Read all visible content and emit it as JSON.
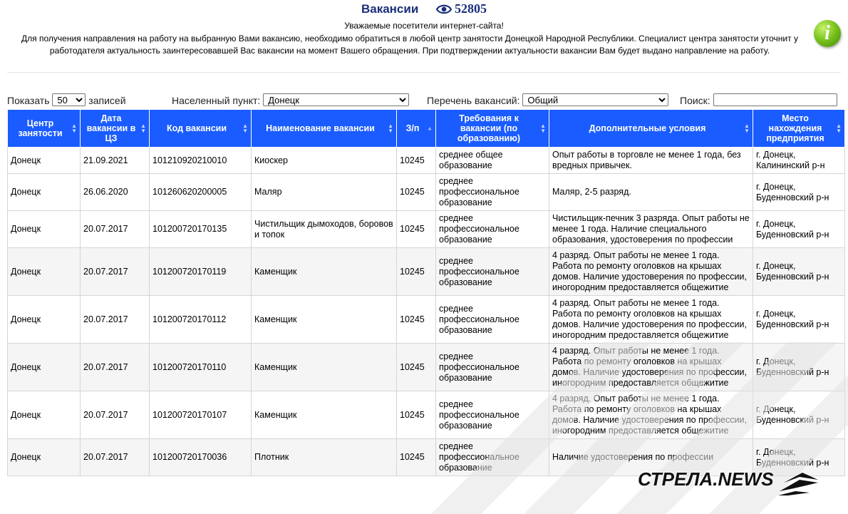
{
  "header": {
    "title": "Вакансии",
    "views_count": "52805",
    "greeting": "Уважаемые посетители интернет-сайта!",
    "notice_line1": "Для получения направления на работу на выбранную Вами вакансию, необходимо обратиться в любой центр занятости Донецкой Народной Республики. Специалист центра занятости уточнит у",
    "notice_line2": "работодателя актуальность заинтересовавшей Вас вакансии на момент Вашего обращения. При подтверждении актуальности вакансии Вам будет выдано направление на работу.",
    "info_icon_glyph": "i"
  },
  "controls": {
    "show_label": "Показать",
    "show_value": "50",
    "records_label": "записей",
    "locality_label": "Населенный пункт:",
    "locality_value": "Донецк",
    "vacancy_list_label": "Перечень вакансий:",
    "vacancy_list_value": "Общий",
    "search_label": "Поиск:",
    "search_value": ""
  },
  "table": {
    "columns": [
      "Центр занятости",
      "Дата вакансии в ЦЗ",
      "Код вакансии",
      "Наименование вакансии",
      "З/п",
      "Требования к вакансии (по образованию)",
      "Дополнительные условия",
      "Место нахождения предприятия"
    ],
    "rows": [
      [
        "Донецк",
        "21.09.2021",
        "101210920210010",
        "Киоскер",
        "10245",
        "среднее общее образование",
        "Опыт работы в торговле не менее 1 года, без вредных привычек.",
        "г. Донецк, Калининский р-н"
      ],
      [
        "Донецк",
        "26.06.2020",
        "101260620200005",
        "Маляр",
        "10245",
        "среднее профессиональное образование",
        "Маляр, 2-5 разряд.",
        "г. Донецк, Буденновский р-н"
      ],
      [
        "Донецк",
        "20.07.2017",
        "101200720170135",
        "Чистильщик дымоходов, боровов и топок",
        "10245",
        "среднее профессиональное образование",
        "Чистильщик-печник 3 разряда. Опыт работы не менее 1 года. Наличие специального образования, удостоверения по профессии",
        "г. Донецк, Буденновский р-н"
      ],
      [
        "Донецк",
        "20.07.2017",
        "101200720170119",
        "Каменщик",
        "10245",
        "среднее профессиональное образование",
        "4 разряд. Опыт работы не менее 1 года. Работа по ремонту оголовков на крышах домов. Наличие удостоверения по профессии, иногородним предоставляется общежитие",
        "г. Донецк, Буденновский р-н"
      ],
      [
        "Донецк",
        "20.07.2017",
        "101200720170112",
        "Каменщик",
        "10245",
        "среднее профессиональное образование",
        "4 разряд. Опыт работы не менее 1 года. Работа по ремонту оголовков на крышах домов. Наличие удостоверения по профессии, иногородним предоставляется общежитие",
        "г. Донецк, Буденновский р-н"
      ],
      [
        "Донецк",
        "20.07.2017",
        "101200720170110",
        "Каменщик",
        "10245",
        "среднее профессиональное образование",
        "4 разряд. Опыт работы не менее 1 года. Работа по ремонту оголовков на крышах домов. Наличие удостоверения по профессии, иногородним предоставляется общежитие",
        "г. Донецк, Буденновский р-н"
      ],
      [
        "Донецк",
        "20.07.2017",
        "101200720170107",
        "Каменщик",
        "10245",
        "среднее профессиональное образование",
        "4 разряд. Опыт работы не менее 1 года. Работа по ремонту оголовков на крышах домов. Наличие удостоверения по профессии, иногородним предоставляется общежитие",
        "г. Донецк, Буденновский р-н"
      ],
      [
        "Донецк",
        "20.07.2017",
        "101200720170036",
        "Плотник",
        "10245",
        "среднее профессиональное образование",
        "Наличие удостоверения по профессии",
        "г. Донецк, Буденновский р-н"
      ]
    ]
  },
  "watermark": {
    "brand_text": "СТРЕЛА.NEWS"
  },
  "colors": {
    "header_bg": "#1a5cff",
    "title": "#1a2f7a",
    "info_icon": "#7cc51d"
  },
  "icons": {
    "views": "eye-icon",
    "info": "info-icon",
    "sort": "sort-arrows-icon"
  }
}
